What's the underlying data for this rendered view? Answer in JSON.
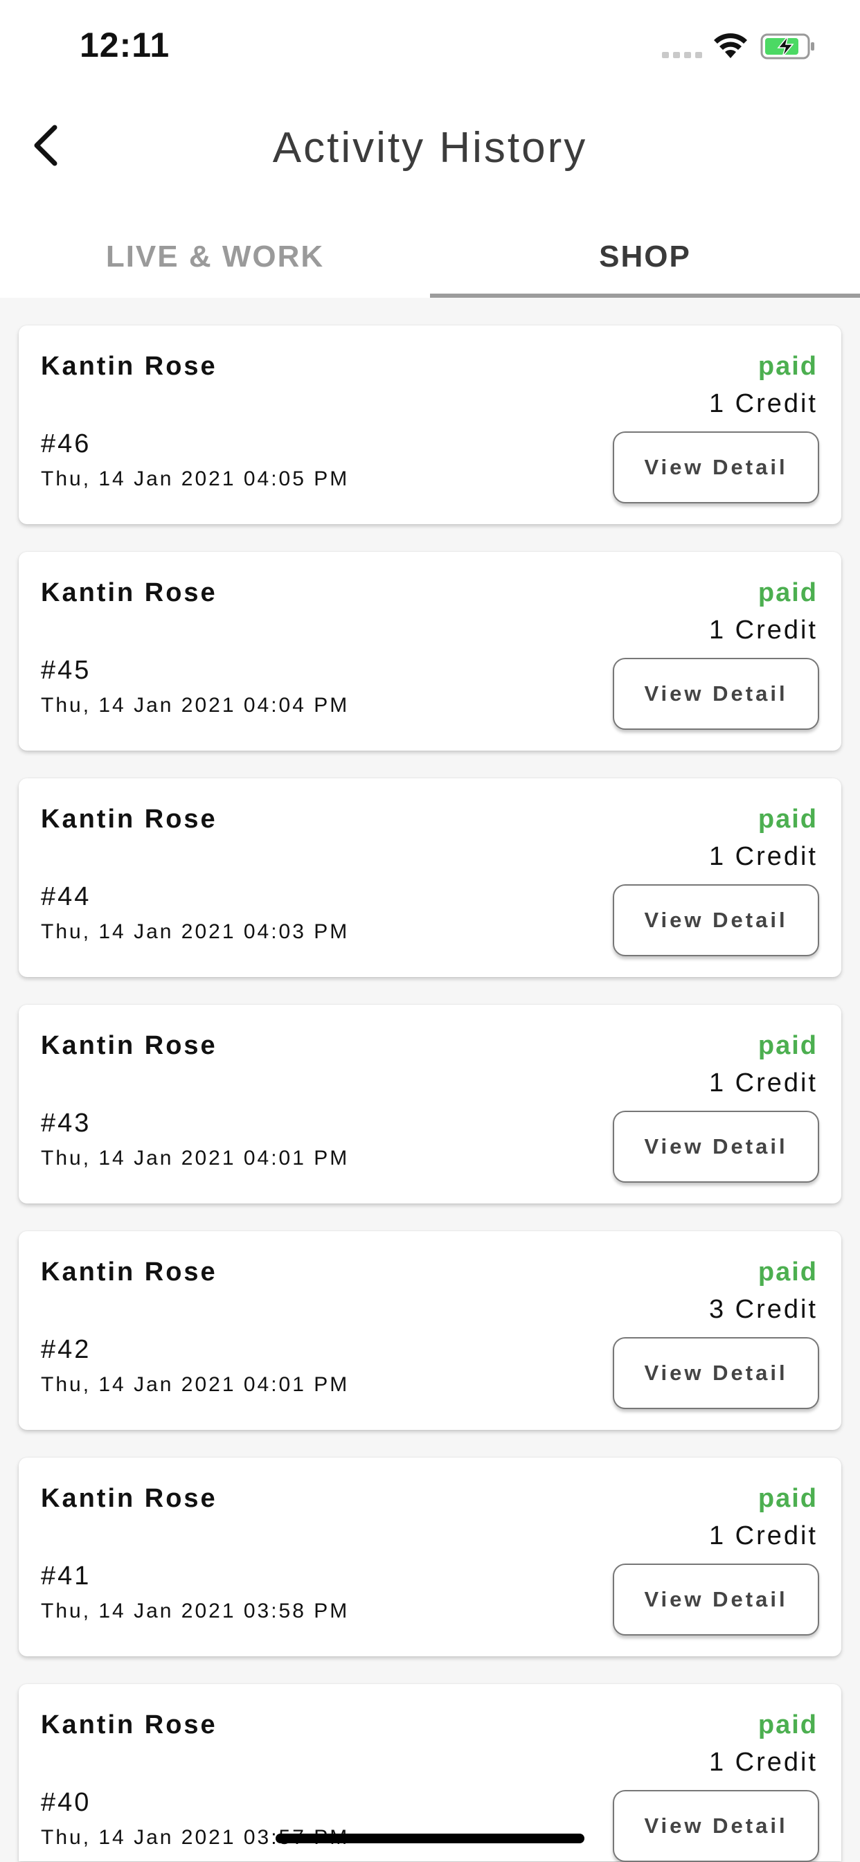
{
  "status_bar": {
    "time": "12:11"
  },
  "header": {
    "title": "Activity History"
  },
  "tabs": [
    {
      "label": "LIVE & WORK",
      "active": false
    },
    {
      "label": "SHOP",
      "active": true
    }
  ],
  "colors": {
    "paid": "#4caf50",
    "tab_indicator": "#9c9c9c",
    "battery": "#4cd964"
  },
  "transactions": [
    {
      "merchant": "Kantin Rose",
      "status": "paid",
      "credit": "1 Credit",
      "id": "#46",
      "date": "Thu, 14 Jan 2021 04:05 PM",
      "button": "View Detail"
    },
    {
      "merchant": "Kantin Rose",
      "status": "paid",
      "credit": "1 Credit",
      "id": "#45",
      "date": "Thu, 14 Jan 2021 04:04 PM",
      "button": "View Detail"
    },
    {
      "merchant": "Kantin Rose",
      "status": "paid",
      "credit": "1 Credit",
      "id": "#44",
      "date": "Thu, 14 Jan 2021 04:03 PM",
      "button": "View Detail"
    },
    {
      "merchant": "Kantin Rose",
      "status": "paid",
      "credit": "1 Credit",
      "id": "#43",
      "date": "Thu, 14 Jan 2021 04:01 PM",
      "button": "View Detail"
    },
    {
      "merchant": "Kantin Rose",
      "status": "paid",
      "credit": "3 Credit",
      "id": "#42",
      "date": "Thu, 14 Jan 2021 04:01 PM",
      "button": "View Detail"
    },
    {
      "merchant": "Kantin Rose",
      "status": "paid",
      "credit": "1 Credit",
      "id": "#41",
      "date": "Thu, 14 Jan 2021 03:58 PM",
      "button": "View Detail"
    },
    {
      "merchant": "Kantin Rose",
      "status": "paid",
      "credit": "1 Credit",
      "id": "#40",
      "date": "Thu, 14 Jan 2021 03:57 PM",
      "button": "View Detail"
    }
  ]
}
